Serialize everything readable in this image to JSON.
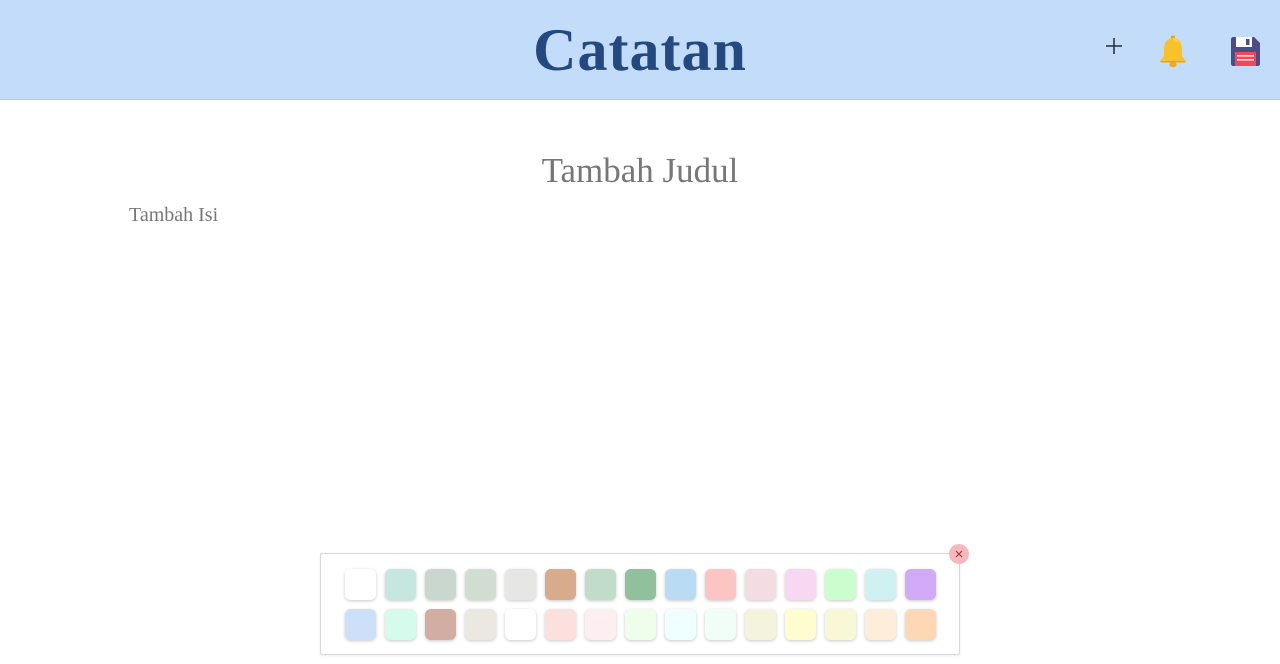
{
  "header": {
    "title": "Catatan",
    "add_icon": "plus-icon",
    "bell_icon": "bell-icon",
    "save_icon": "floppy-disk-icon"
  },
  "note": {
    "title_placeholder": "Tambah Judul",
    "body_placeholder": "Tambah Isi"
  },
  "colors": {
    "header_bg": "#c3dcfa",
    "title_color": "#23497e",
    "placeholder_color": "#777777"
  },
  "palette": {
    "close_icon": "close-icon",
    "rows": [
      [
        "#ffffff",
        "#c6e6e0",
        "#cad7ce",
        "#d2ddd2",
        "#e6e7e4",
        "#d7ab8b",
        "#c2dcca",
        "#90c09c",
        "#b9dbf3",
        "#fdc4c4",
        "#f4dde2",
        "#f8d7f3",
        "#ccfdce",
        "#cff1f1",
        "#d1aaf8"
      ],
      [
        "#cde0fa",
        "#d4fbec",
        "#d2aea2",
        "#ebe8e1",
        "#ffffff",
        "#fce0de",
        "#fdeef2",
        "#effeea",
        "#effeff",
        "#f0fef7",
        "#f4f4dc",
        "#fefdcf",
        "#f8f8d6",
        "#feeed9",
        "#fed8b4"
      ]
    ]
  }
}
